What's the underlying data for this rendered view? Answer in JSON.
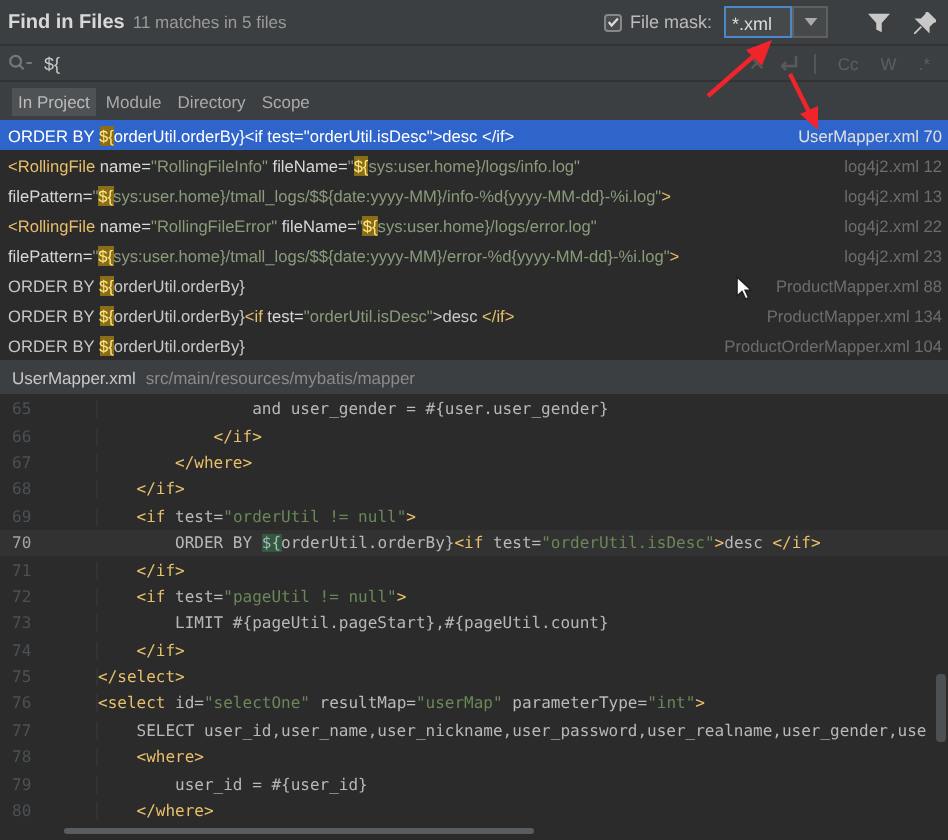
{
  "dialog": {
    "title": "Find in Files",
    "summary": "11 matches in 5 files",
    "file_mask": {
      "checked": true,
      "label": "File mask:",
      "value": "*.xml"
    }
  },
  "search": {
    "value": "${",
    "toggles": [
      "Cc",
      "W",
      ".*"
    ]
  },
  "scopes": [
    {
      "label": "In Project",
      "selected": true
    },
    {
      "label": "Module",
      "selected": false
    },
    {
      "label": "Directory",
      "selected": false
    },
    {
      "label": "Scope",
      "selected": false
    }
  ],
  "results": [
    {
      "selected": true,
      "location": "UserMapper.xml 70",
      "segments": [
        {
          "kind": "plain",
          "text": "ORDER BY "
        },
        {
          "kind": "match",
          "text": "${"
        },
        {
          "kind": "plain",
          "text": "orderUtil.orderBy}<if test=\"orderUtil.isDesc\">desc </if>"
        }
      ]
    },
    {
      "selected": false,
      "location": "log4j2.xml 12",
      "segments": [
        {
          "kind": "tag",
          "text": "<RollingFile"
        },
        {
          "kind": "attr",
          "text": " name="
        },
        {
          "kind": "value",
          "text": "\"RollingFileInfo\""
        },
        {
          "kind": "attr",
          "text": " fileName="
        },
        {
          "kind": "value",
          "text": "\""
        },
        {
          "kind": "match",
          "text": "${"
        },
        {
          "kind": "value",
          "text": "sys:user.home}/logs/info.log\""
        }
      ]
    },
    {
      "selected": false,
      "location": "log4j2.xml 13",
      "segments": [
        {
          "kind": "attr",
          "text": "filePattern="
        },
        {
          "kind": "value",
          "text": "\""
        },
        {
          "kind": "match",
          "text": "${"
        },
        {
          "kind": "value",
          "text": "sys:user.home}/tmall_logs/$${date:yyyy-MM}/info-%d{yyyy-MM-dd}-%i.log\""
        },
        {
          "kind": "tag",
          "text": ">"
        }
      ]
    },
    {
      "selected": false,
      "location": "log4j2.xml 22",
      "segments": [
        {
          "kind": "tag",
          "text": "<RollingFile"
        },
        {
          "kind": "attr",
          "text": " name="
        },
        {
          "kind": "value",
          "text": "\"RollingFileError\""
        },
        {
          "kind": "attr",
          "text": " fileName="
        },
        {
          "kind": "value",
          "text": "\""
        },
        {
          "kind": "match",
          "text": "${"
        },
        {
          "kind": "value",
          "text": "sys:user.home}/logs/error.log\""
        }
      ]
    },
    {
      "selected": false,
      "location": "log4j2.xml 23",
      "segments": [
        {
          "kind": "attr",
          "text": "filePattern="
        },
        {
          "kind": "value",
          "text": "\""
        },
        {
          "kind": "match",
          "text": "${"
        },
        {
          "kind": "value",
          "text": "sys:user.home}/tmall_logs/$${date:yyyy-MM}/error-%d{yyyy-MM-dd}-%i.log\""
        },
        {
          "kind": "tag",
          "text": ">"
        }
      ]
    },
    {
      "selected": false,
      "location": "ProductMapper.xml 88",
      "segments": [
        {
          "kind": "plain",
          "text": "ORDER BY "
        },
        {
          "kind": "match",
          "text": "${"
        },
        {
          "kind": "plain",
          "text": "orderUtil.orderBy}"
        }
      ]
    },
    {
      "selected": false,
      "location": "ProductMapper.xml 134",
      "segments": [
        {
          "kind": "plain",
          "text": "ORDER BY "
        },
        {
          "kind": "match",
          "text": "${"
        },
        {
          "kind": "plain",
          "text": "orderUtil.orderBy}"
        },
        {
          "kind": "tag",
          "text": "<if"
        },
        {
          "kind": "attr",
          "text": " test="
        },
        {
          "kind": "value",
          "text": "\"orderUtil.isDesc\""
        },
        {
          "kind": "plain",
          "text": ">desc "
        },
        {
          "kind": "tag",
          "text": "</if>"
        }
      ]
    },
    {
      "selected": false,
      "location": "ProductOrderMapper.xml 104",
      "segments": [
        {
          "kind": "plain",
          "text": "ORDER BY "
        },
        {
          "kind": "match",
          "text": "${"
        },
        {
          "kind": "plain",
          "text": "orderUtil.orderBy}"
        }
      ]
    }
  ],
  "preview": {
    "file": "UserMapper.xml",
    "path": "src/main/resources/mybatis/mapper",
    "lines": [
      {
        "number": "65",
        "current": false,
        "segments": [
          {
            "kind": "plain",
            "text": "                and user_gender = #{user.user_gender}"
          }
        ]
      },
      {
        "number": "66",
        "current": false,
        "segments": [
          {
            "kind": "tag",
            "text": "            </if>"
          }
        ]
      },
      {
        "number": "67",
        "current": false,
        "segments": [
          {
            "kind": "tag",
            "text": "        </where>"
          }
        ]
      },
      {
        "number": "68",
        "current": false,
        "segments": [
          {
            "kind": "tag",
            "text": "    </if>"
          }
        ]
      },
      {
        "number": "69",
        "current": false,
        "segments": [
          {
            "kind": "tag",
            "text": "    <if"
          },
          {
            "kind": "attr",
            "text": " test="
          },
          {
            "kind": "value",
            "text": "\"orderUtil != null\""
          },
          {
            "kind": "tag",
            "text": ">"
          }
        ]
      },
      {
        "number": "70",
        "current": true,
        "segments": [
          {
            "kind": "plain",
            "text": "        ORDER BY "
          },
          {
            "kind": "match",
            "text": "${"
          },
          {
            "kind": "plain",
            "text": "orderUtil.orderBy}"
          },
          {
            "kind": "tag",
            "text": "<if"
          },
          {
            "kind": "attr",
            "text": " test="
          },
          {
            "kind": "value",
            "text": "\"orderUtil.isDesc\""
          },
          {
            "kind": "tag",
            "text": ">"
          },
          {
            "kind": "plain",
            "text": "desc "
          },
          {
            "kind": "tag",
            "text": "</if>"
          }
        ]
      },
      {
        "number": "71",
        "current": false,
        "segments": [
          {
            "kind": "tag",
            "text": "    </if>"
          }
        ]
      },
      {
        "number": "72",
        "current": false,
        "segments": [
          {
            "kind": "tag",
            "text": "    <if"
          },
          {
            "kind": "attr",
            "text": " test="
          },
          {
            "kind": "value",
            "text": "\"pageUtil != null\""
          },
          {
            "kind": "tag",
            "text": ">"
          }
        ]
      },
      {
        "number": "73",
        "current": false,
        "segments": [
          {
            "kind": "plain",
            "text": "        LIMIT #{pageUtil.pageStart},#{pageUtil.count}"
          }
        ]
      },
      {
        "number": "74",
        "current": false,
        "segments": [
          {
            "kind": "tag",
            "text": "    </if>"
          }
        ]
      },
      {
        "number": "75",
        "current": false,
        "segments": [
          {
            "kind": "tag",
            "text": "</select>"
          }
        ]
      },
      {
        "number": "76",
        "current": false,
        "segments": [
          {
            "kind": "tag",
            "text": "<select"
          },
          {
            "kind": "attr",
            "text": " id="
          },
          {
            "kind": "value",
            "text": "\"selectOne\""
          },
          {
            "kind": "attr",
            "text": " resultMap="
          },
          {
            "kind": "value",
            "text": "\"userMap\""
          },
          {
            "kind": "attr",
            "text": " parameterType="
          },
          {
            "kind": "value",
            "text": "\"int\""
          },
          {
            "kind": "tag",
            "text": ">"
          }
        ]
      },
      {
        "number": "77",
        "current": false,
        "segments": [
          {
            "kind": "plain",
            "text": "    SELECT user_id,user_name,user_nickname,user_password,user_realname,user_gender,use"
          }
        ]
      },
      {
        "number": "78",
        "current": false,
        "segments": [
          {
            "kind": "tag",
            "text": "    <where>"
          }
        ]
      },
      {
        "number": "79",
        "current": false,
        "segments": [
          {
            "kind": "plain",
            "text": "        user_id = #{user_id}"
          }
        ]
      },
      {
        "number": "80",
        "current": false,
        "segments": [
          {
            "kind": "tag",
            "text": "    </where>"
          }
        ]
      }
    ]
  }
}
